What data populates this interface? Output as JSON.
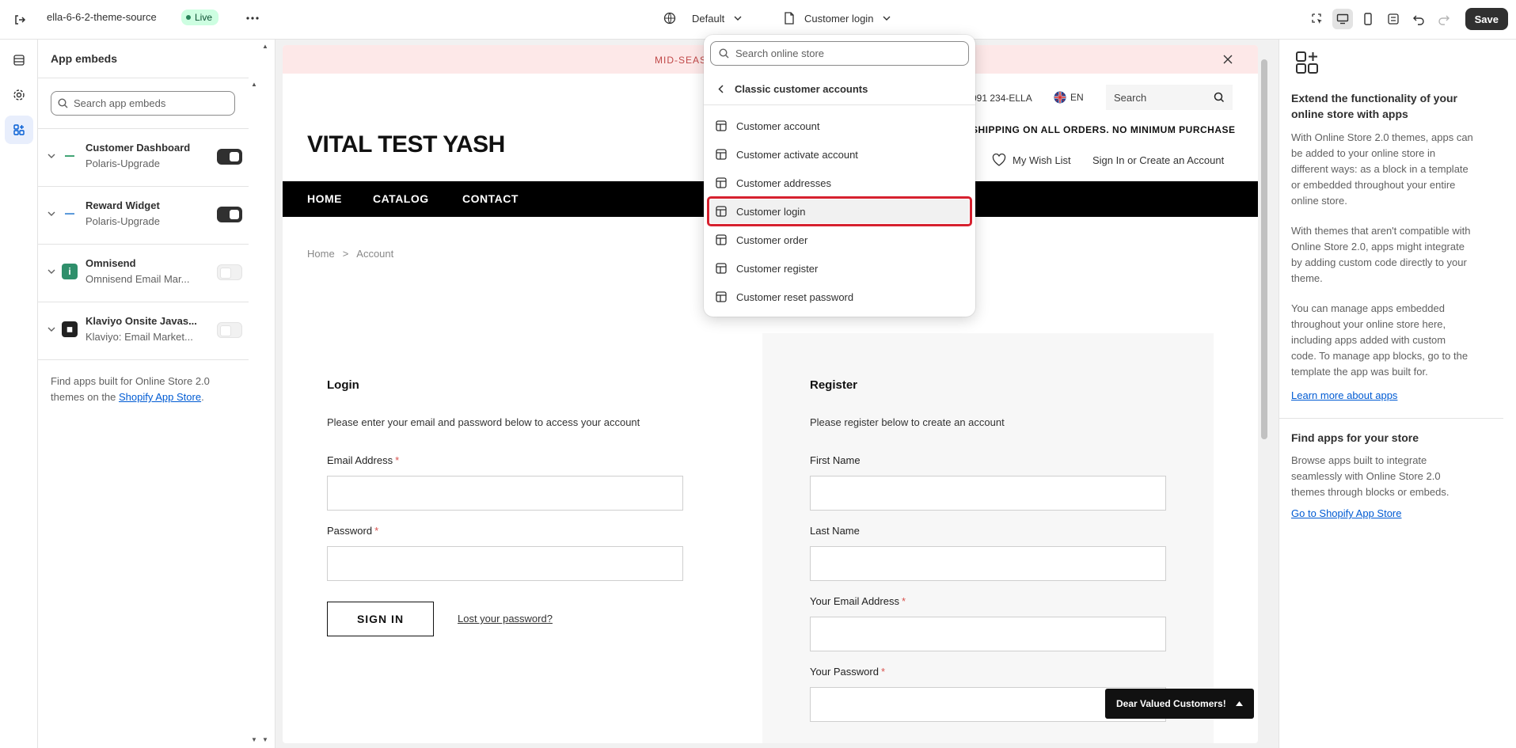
{
  "topbar": {
    "theme_name": "ella-6-6-2-theme-source",
    "live_badge": "Live",
    "context_label": "Default",
    "template_label": "Customer login",
    "save_label": "Save"
  },
  "panel": {
    "title": "App embeds",
    "search_placeholder": "Search app embeds",
    "apps": [
      {
        "name": "Customer Dashboard",
        "sub": "Polaris-Upgrade",
        "enabled": true
      },
      {
        "name": "Reward Widget",
        "sub": "Polaris-Upgrade",
        "enabled": true
      },
      {
        "name": "Omnisend",
        "sub": "Omnisend Email Mar...",
        "enabled": false
      },
      {
        "name": "Klaviyo Onsite Javas...",
        "sub": "Klaviyo: Email Market...",
        "enabled": false
      }
    ],
    "footer_text": "Find apps built for Online Store 2.0 themes on the ",
    "footer_link": "Shopify App Store",
    "footer_end": "."
  },
  "dropdown": {
    "search_placeholder": "Search online store",
    "back_label": "Classic customer accounts",
    "items": [
      "Customer account",
      "Customer activate account",
      "Customer addresses",
      "Customer login",
      "Customer order",
      "Customer register",
      "Customer reset password"
    ],
    "selected": "Customer login"
  },
  "preview": {
    "announcement": "MID-SEAS",
    "phone": "091 234-ELLA",
    "lang": "EN",
    "search_placeholder": "Search",
    "shipping": "SHIPPING ON ALL ORDERS. NO MINIMUM PURCHASE",
    "logo": "VITAL TEST YASH",
    "wishlist": "My Wish List",
    "signin": "Sign In or Create an Account",
    "nav": [
      "HOME",
      "CATALOG",
      "CONTACT"
    ],
    "breadcrumb": [
      "Home",
      ">",
      "Account"
    ],
    "login": {
      "title": "Login",
      "desc": "Please enter your email and password below to access your account",
      "email_label": "Email Address",
      "password_label": "Password",
      "button": "SIGN IN",
      "lost": "Lost your password?"
    },
    "register": {
      "title": "Register",
      "desc": "Please register below to create an account",
      "first_name": "First Name",
      "last_name": "Last Name",
      "email_label": "Your Email Address",
      "password_label": "Your Password"
    },
    "required_mark": "*",
    "dear_button": "Dear Valued Customers!"
  },
  "info": {
    "heading1": "Extend the functionality of your online store with apps",
    "p1": "With Online Store 2.0 themes, apps can be added to your online store in different ways: as a block in a template or embedded throughout your entire online store.",
    "p2": "With themes that aren't compatible with Online Store 2.0, apps might integrate by adding custom code directly to your theme.",
    "p3": "You can manage apps embedded throughout your online store here, including apps added with custom code. To manage app blocks, go to the template the app was built for.",
    "link1": "Learn more about apps",
    "heading2": "Find apps for your store",
    "p4": "Browse apps built to integrate seamlessly with Online Store 2.0 themes through blocks or embeds.",
    "link2": "Go to Shopify App Store"
  },
  "colors": {
    "accent": "#303030",
    "highlight": "#d6212f",
    "link": "#005bd3",
    "announce_bg": "#fde8e8"
  }
}
